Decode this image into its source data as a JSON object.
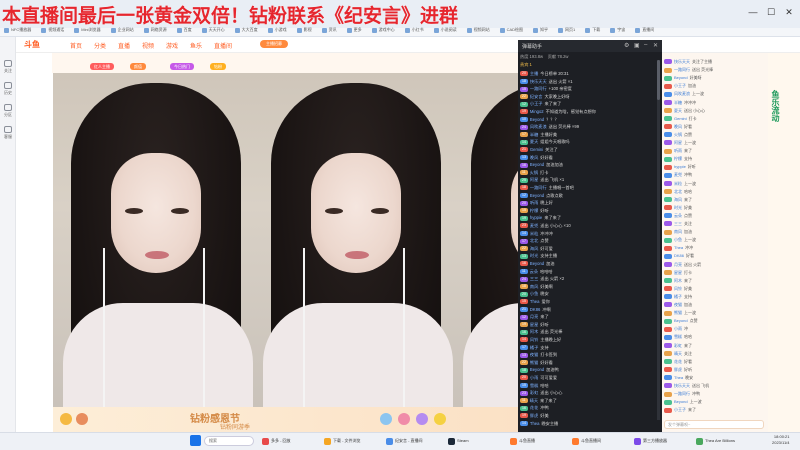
{
  "banner": {
    "text": "本直播间最后一张黄金双倍！钻粉联系《纪安言》进群"
  },
  "window": {
    "minimize": "—",
    "maximize": "☐",
    "close": "✕"
  },
  "bookmarks": [
    "NFC播放器",
    "视频通话",
    "Mini浏览器",
    "企业网站",
    "网络资源",
    "百度",
    "天天开心",
    "大大百度",
    "小游戏",
    "影视",
    "资讯",
    "更多",
    "游戏中心",
    "小红书",
    "小说阅读",
    "视频网站",
    "CAD绘图",
    "知乎",
    "网页1",
    "下载",
    "宇宙",
    "直播间"
  ],
  "sidebar": [
    {
      "label": "关注",
      "icon": "follow-icon"
    },
    {
      "label": "历史",
      "icon": "history-icon"
    },
    {
      "label": "分区",
      "icon": "category-icon"
    },
    {
      "label": "客服",
      "icon": "service-icon"
    }
  ],
  "sitenav": {
    "logo": "斗鱼",
    "links": [
      "首页",
      "分类",
      "直播",
      "视频",
      "游戏",
      "鱼乐",
      "直播间"
    ],
    "pill": "主播招募"
  },
  "stream": {
    "tags": [
      "红人主播",
      "颜值",
      "今日热门",
      "钻粉"
    ]
  },
  "gift": {
    "title": "钻粉感恩节",
    "subtitle": "钻粉同游季"
  },
  "chat": {
    "title": "弹幕助手",
    "stats": [
      "热度 193.8w",
      "贡献 78.2w"
    ],
    "rank": "贵宾 1",
    "lines": [
      {
        "level": "20",
        "user": "主播",
        "text": "今日榜单 20:31"
      },
      {
        "level": "18",
        "user": "快乐天天",
        "text": "送出 火箭 ×1"
      },
      {
        "level": "15",
        "user": "一路同行",
        "text": "+100 亲密度"
      },
      {
        "level": "22",
        "user": "纪安言",
        "text": "大家晚上好呀"
      },
      {
        "level": "12",
        "user": "小王子",
        "text": "来了来了"
      },
      {
        "level": "19",
        "user": "Mingo2",
        "text": "不知道为啥，感觉有点想你"
      },
      {
        "level": "10",
        "user": "Beyond",
        "text": "？？？"
      },
      {
        "level": "24",
        "user": "风吹麦浪",
        "text": "送出 荧光棒 ×99"
      },
      {
        "level": "17",
        "user": "半糖",
        "text": "主播好美"
      },
      {
        "level": "14",
        "user": "夏天",
        "text": "姐姐今天唱歌吗"
      },
      {
        "level": "21",
        "user": "Gemini",
        "text": "关注了"
      },
      {
        "level": "13",
        "user": "晚风",
        "text": "好好看"
      },
      {
        "level": "16",
        "user": "Beyond",
        "text": "加油加油"
      },
      {
        "level": "11",
        "user": "火锅",
        "text": "打卡"
      },
      {
        "level": "25",
        "user": "阿星",
        "text": "送出 飞机 ×1"
      },
      {
        "level": "18",
        "user": "一路同行",
        "text": "主播唱一首吧"
      },
      {
        "level": "12",
        "user": "Beyond",
        "text": "点歌点歌"
      },
      {
        "level": "20",
        "user": "听雨",
        "text": "晚上好"
      },
      {
        "level": "15",
        "user": "柠檬",
        "text": "好听"
      },
      {
        "level": "19",
        "user": "hyppie",
        "text": "来了来了"
      },
      {
        "level": "23",
        "user": "麦兜",
        "text": "送出 小心心 ×10"
      },
      {
        "level": "14",
        "user": "米粒",
        "text": "冲冲冲"
      },
      {
        "level": "17",
        "user": "北北",
        "text": "点赞"
      },
      {
        "level": "22",
        "user": "海风",
        "text": "好可爱"
      },
      {
        "level": "13",
        "user": "时光",
        "text": "支持主播"
      },
      {
        "level": "16",
        "user": "Beyond",
        "text": "加油"
      },
      {
        "level": "11",
        "user": "云朵",
        "text": "哈哈哈"
      },
      {
        "level": "24",
        "user": "三三",
        "text": "送出 火箭 ×2"
      },
      {
        "level": "18",
        "user": "南风",
        "text": "好美啊"
      },
      {
        "level": "20",
        "user": "小鱼",
        "text": "晚安"
      },
      {
        "level": "15",
        "user": "Thea",
        "text": "爱你"
      },
      {
        "level": "21",
        "user": "DK86",
        "text": "冲啊"
      },
      {
        "level": "12",
        "user": "月亮",
        "text": "来了"
      },
      {
        "level": "19",
        "user": "星星",
        "text": "好听"
      },
      {
        "level": "16",
        "user": "阿木",
        "text": "送出 荧光棒"
      },
      {
        "level": "14",
        "user": "风铃",
        "text": "主播晚上好"
      },
      {
        "level": "17",
        "user": "橘子",
        "text": "支持"
      },
      {
        "level": "13",
        "user": "夜猫",
        "text": "打卡签到"
      },
      {
        "level": "22",
        "user": "熊猫",
        "text": "好好看"
      },
      {
        "level": "18",
        "user": "Beyond",
        "text": "加油鸭"
      },
      {
        "level": "20",
        "user": "小雨",
        "text": "可可爱爱"
      },
      {
        "level": "15",
        "user": "雪糕",
        "text": "哈哈"
      },
      {
        "level": "23",
        "user": "彩虹",
        "text": "送出 小心心"
      },
      {
        "level": "11",
        "user": "晴天",
        "text": "来了来了"
      },
      {
        "level": "16",
        "user": "花花",
        "text": "冲鸭"
      },
      {
        "level": "19",
        "user": "胖虎",
        "text": "好美"
      },
      {
        "level": "14",
        "user": "Thea",
        "text": "晚安主播"
      }
    ]
  },
  "rightpanel": {
    "lines": [
      {
        "user": "快乐天天",
        "text": "关注了主播"
      },
      {
        "user": "一路同行",
        "text": "送出 荧光棒"
      },
      {
        "user": "Beyond",
        "text": "好美呀"
      },
      {
        "user": "小王子",
        "text": "加油"
      },
      {
        "user": "风吹麦浪",
        "text": "上一波"
      },
      {
        "user": "半糖",
        "text": "冲冲冲"
      },
      {
        "user": "夏天",
        "text": "送出 小心心"
      },
      {
        "user": "Gemini",
        "text": "打卡"
      },
      {
        "user": "晚风",
        "text": "好看"
      },
      {
        "user": "火锅",
        "text": "点赞"
      },
      {
        "user": "阿星",
        "text": "上一波"
      },
      {
        "user": "听雨",
        "text": "来了"
      },
      {
        "user": "柠檬",
        "text": "支持"
      },
      {
        "user": "hyppie",
        "text": "好听"
      },
      {
        "user": "麦兜",
        "text": "冲鸭"
      },
      {
        "user": "米粒",
        "text": "上一波"
      },
      {
        "user": "北北",
        "text": "哈哈"
      },
      {
        "user": "海风",
        "text": "来了"
      },
      {
        "user": "时光",
        "text": "好美"
      },
      {
        "user": "云朵",
        "text": "点赞"
      },
      {
        "user": "三三",
        "text": "关注"
      },
      {
        "user": "南风",
        "text": "加油"
      },
      {
        "user": "小鱼",
        "text": "上一波"
      },
      {
        "user": "Thea",
        "text": "冲冲"
      },
      {
        "user": "DK86",
        "text": "好看"
      },
      {
        "user": "月亮",
        "text": "送出 火箭"
      },
      {
        "user": "星星",
        "text": "打卡"
      },
      {
        "user": "阿木",
        "text": "来了"
      },
      {
        "user": "风铃",
        "text": "好美"
      },
      {
        "user": "橘子",
        "text": "支持"
      },
      {
        "user": "夜猫",
        "text": "加油"
      },
      {
        "user": "熊猫",
        "text": "上一波"
      },
      {
        "user": "Beyond",
        "text": "点赞"
      },
      {
        "user": "小雨",
        "text": "冲"
      },
      {
        "user": "雪糕",
        "text": "哈哈"
      },
      {
        "user": "彩虹",
        "text": "来了"
      },
      {
        "user": "晴天",
        "text": "关注"
      },
      {
        "user": "花花",
        "text": "好看"
      },
      {
        "user": "胖虎",
        "text": "好听"
      },
      {
        "user": "Thea",
        "text": "晚安"
      },
      {
        "user": "快乐天天",
        "text": "送出 飞机"
      },
      {
        "user": "一路同行",
        "text": "冲鸭"
      },
      {
        "user": "Beyond",
        "text": "上一波"
      },
      {
        "user": "小王子",
        "text": "来了"
      }
    ],
    "input_placeholder": "发个弹幕呗~"
  },
  "promo": {
    "title": "鱼乐流动"
  },
  "taskbar": {
    "search": "搜索",
    "items": [
      "多多 - 回放",
      "下载 - 文件浏览",
      "纪安言 - 直播间",
      "Steam",
      "斗鱼直播",
      "斗鱼直播间",
      "第三方播放器",
      "Thea Are Billions"
    ],
    "time": "18:00:21",
    "date": "2023/11/4"
  }
}
